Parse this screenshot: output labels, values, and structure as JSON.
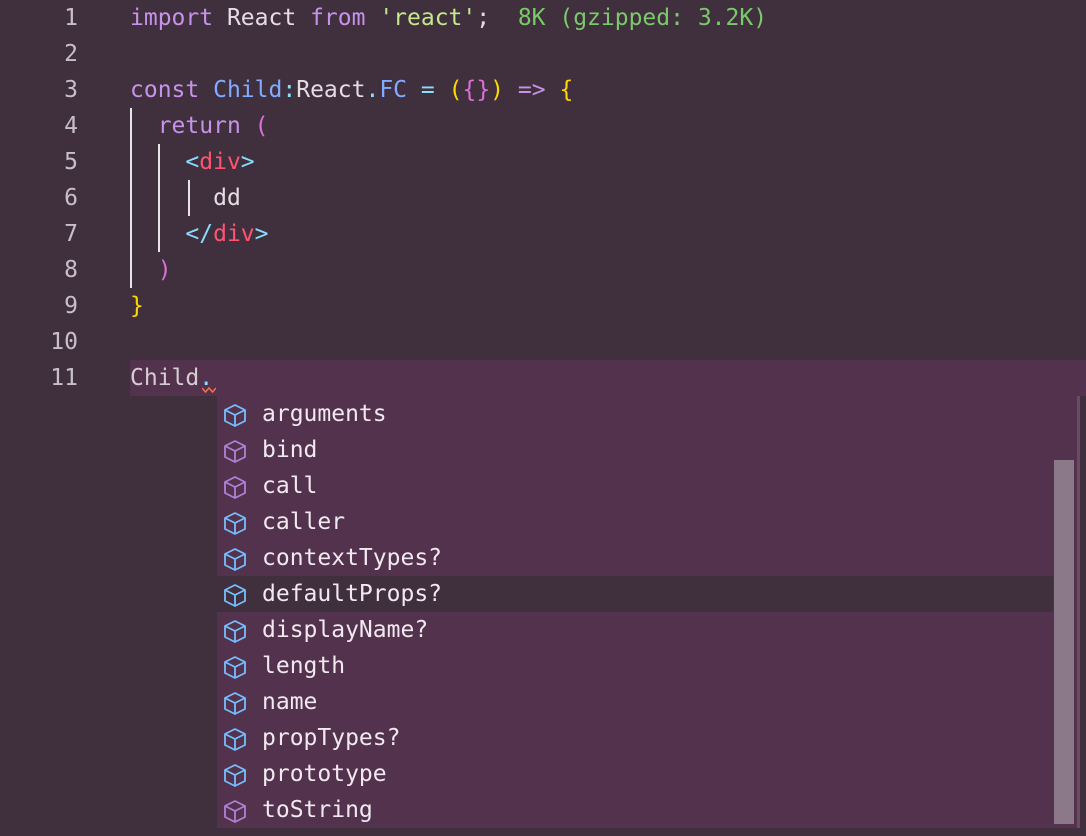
{
  "editor": {
    "lines": [
      {
        "num": "1"
      },
      {
        "num": "2"
      },
      {
        "num": "3"
      },
      {
        "num": "4"
      },
      {
        "num": "5"
      },
      {
        "num": "6"
      },
      {
        "num": "7"
      },
      {
        "num": "8"
      },
      {
        "num": "9"
      },
      {
        "num": "10"
      },
      {
        "num": "11"
      }
    ],
    "tokens": {
      "l1_import": "import",
      "l1_react": "React",
      "l1_from": "from",
      "l1_str": "'react'",
      "l1_semi": ";",
      "l1_hint": "8K (gzipped: 3.2K)",
      "l3_const": "const",
      "l3_child": "Child",
      "l3_colon": ":",
      "l3_react": "React",
      "l3_dot": ".",
      "l3_fc": "FC",
      "l3_eq": "=",
      "l3_paren_open": "(",
      "l3_braces": "{}",
      "l3_paren_close": ")",
      "l3_arrow": "=>",
      "l3_brace": "{",
      "l4_return": "return",
      "l4_paren": "(",
      "l5_lt": "<",
      "l5_div": "div",
      "l5_gt": ">",
      "l6_text": "dd",
      "l7_lt": "</",
      "l7_div": "div",
      "l7_gt": ">",
      "l8_paren": ")",
      "l9_brace": "}",
      "l11_child": "Child",
      "l11_dot": "."
    }
  },
  "suggestions": [
    {
      "label": "arguments",
      "icon": "field-icon",
      "color": "#75beff"
    },
    {
      "label": "bind",
      "icon": "method-icon",
      "color": "#b180d7"
    },
    {
      "label": "call",
      "icon": "method-icon",
      "color": "#b180d7"
    },
    {
      "label": "caller",
      "icon": "field-icon",
      "color": "#75beff"
    },
    {
      "label": "contextTypes?",
      "icon": "field-icon",
      "color": "#75beff"
    },
    {
      "label": "defaultProps?",
      "icon": "field-icon",
      "color": "#75beff",
      "selected": true
    },
    {
      "label": "displayName?",
      "icon": "field-icon",
      "color": "#75beff"
    },
    {
      "label": "length",
      "icon": "field-icon",
      "color": "#75beff"
    },
    {
      "label": "name",
      "icon": "field-icon",
      "color": "#75beff"
    },
    {
      "label": "propTypes?",
      "icon": "field-icon",
      "color": "#75beff"
    },
    {
      "label": "prototype",
      "icon": "field-icon",
      "color": "#75beff"
    },
    {
      "label": "toString",
      "icon": "method-icon",
      "color": "#b180d7"
    }
  ],
  "colors": {
    "background": "#40303d",
    "suggest_background": "#53324d",
    "selected_row": "#40303d",
    "keyword": "#c792ea",
    "type": "#82aaff",
    "string": "#c3e88d",
    "tag": "#ff5370",
    "import_cost_hint": "#7ac96b"
  }
}
